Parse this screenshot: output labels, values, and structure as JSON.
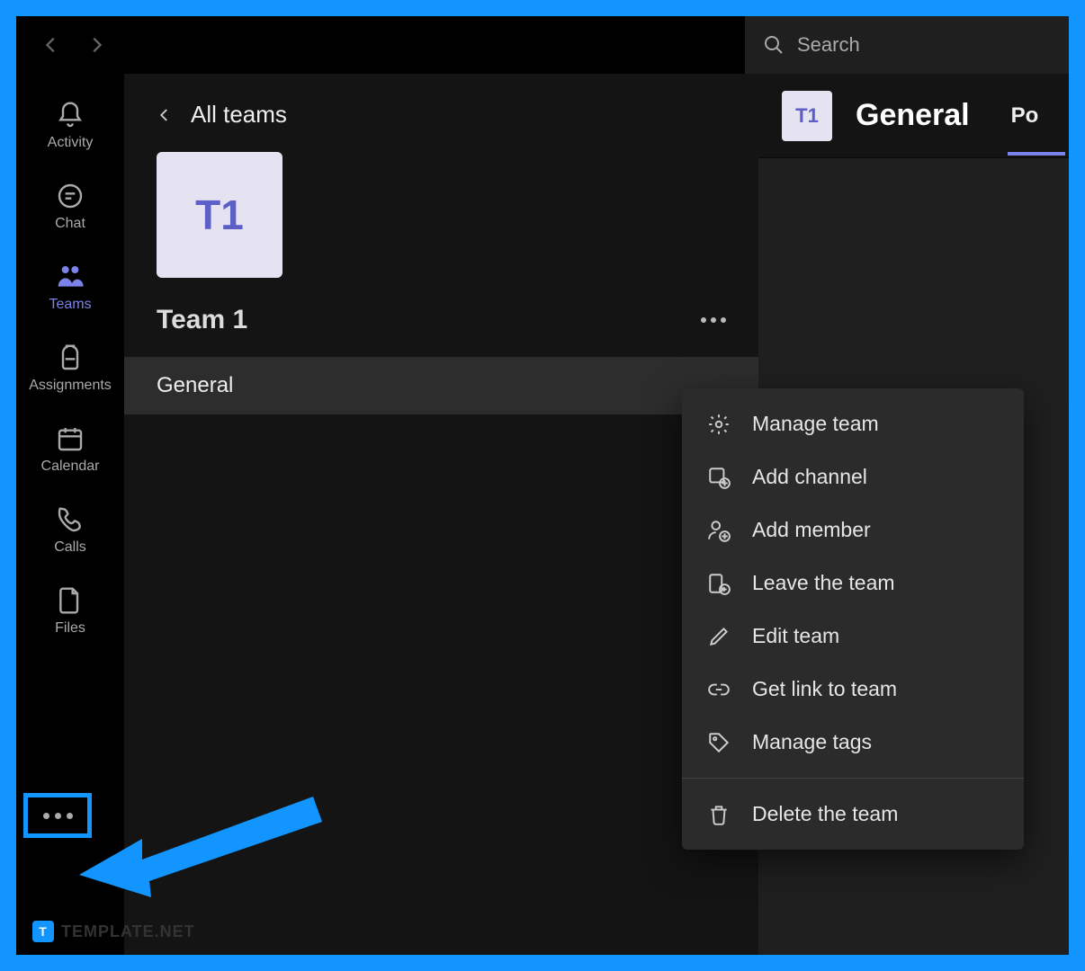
{
  "titlebar": {
    "search_placeholder": "Search"
  },
  "rail": {
    "items": [
      {
        "label": "Activity"
      },
      {
        "label": "Chat"
      },
      {
        "label": "Teams"
      },
      {
        "label": "Assignments"
      },
      {
        "label": "Calendar"
      },
      {
        "label": "Calls"
      },
      {
        "label": "Files"
      }
    ]
  },
  "watermark": {
    "badge": "T",
    "text": "TEMPLATE.NET"
  },
  "panel": {
    "back_label": "All teams",
    "team_initials": "T1",
    "team_name": "Team 1",
    "channel": "General"
  },
  "content": {
    "tile": "T1",
    "title": "General",
    "tab": "Po"
  },
  "menu": {
    "items": [
      {
        "label": "Manage team"
      },
      {
        "label": "Add channel"
      },
      {
        "label": "Add member"
      },
      {
        "label": "Leave the team"
      },
      {
        "label": "Edit team"
      },
      {
        "label": "Get link to team"
      },
      {
        "label": "Manage tags"
      }
    ],
    "delete_label": "Delete the team"
  }
}
